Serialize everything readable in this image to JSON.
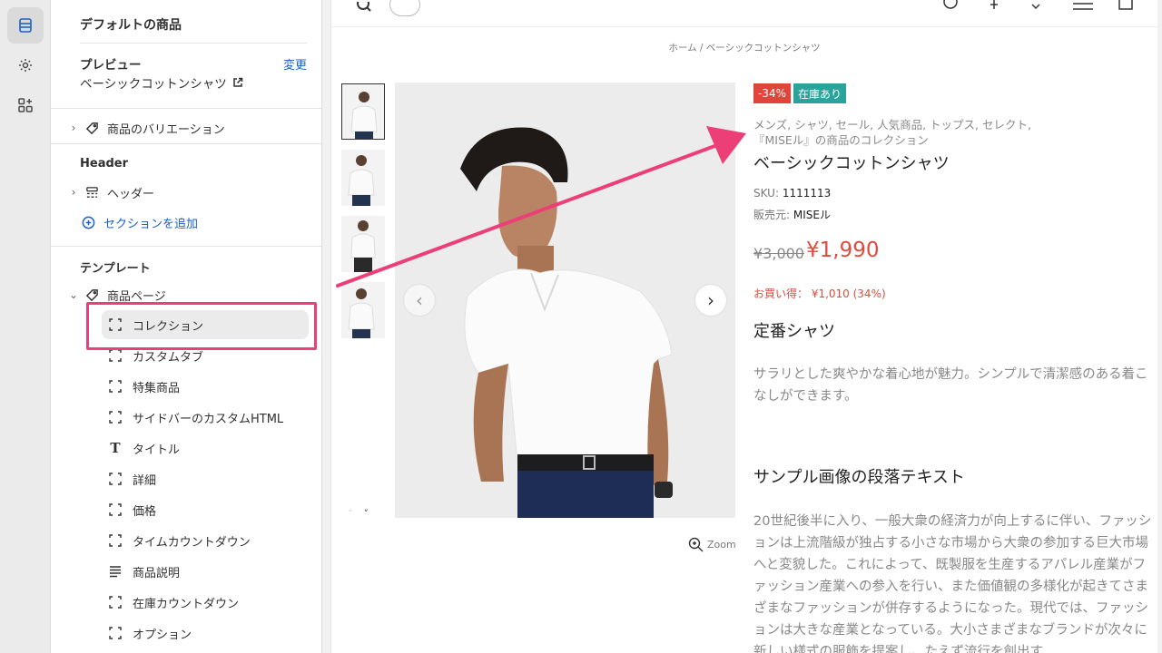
{
  "sidebar": {
    "title": "デフォルトの商品",
    "preview_label": "プレビュー",
    "preview_change": "変更",
    "preview_value": "ベーシックコットンシャツ",
    "variations_label": "商品のバリエーション",
    "header_section": "Header",
    "header_item": "ヘッダー",
    "add_section": "セクションを追加",
    "template_section": "テンプレート",
    "product_page": "商品ページ",
    "items": [
      {
        "label": "コレクション",
        "icon": "block-icon"
      },
      {
        "label": "カスタムタブ",
        "icon": "block-icon"
      },
      {
        "label": "特集商品",
        "icon": "block-icon"
      },
      {
        "label": "サイドバーのカスタムHTML",
        "icon": "block-icon"
      },
      {
        "label": "タイトル",
        "icon": "text-icon"
      },
      {
        "label": "詳細",
        "icon": "block-icon"
      },
      {
        "label": "価格",
        "icon": "block-icon"
      },
      {
        "label": "タイムカウントダウン",
        "icon": "block-icon"
      },
      {
        "label": "商品説明",
        "icon": "lines-icon"
      },
      {
        "label": "在庫カウントダウン",
        "icon": "block-icon"
      },
      {
        "label": "オプション",
        "icon": "block-icon"
      }
    ]
  },
  "preview": {
    "breadcrumb": "ホーム / ベーシックコットンシャツ",
    "zoom_label": "Zoom",
    "badge_discount": "-34%",
    "badge_stock": "在庫あり",
    "tags": "メンズ, シャツ, セール, 人気商品, トップス, セレクト, 『MISEル』の商品のコレクション",
    "title": "ベーシックコットンシャツ",
    "sku_label": "SKU:",
    "sku_value": "1111113",
    "vendor_label": "販売元:",
    "vendor_value": "MISEル",
    "old_price": "¥3,000",
    "new_price": "¥1,990",
    "saving": "お買い得： ¥1,010 (34%)",
    "subtitle": "定番シャツ",
    "description": "サラリとした爽やかな着心地が魅力。シンプルで清潔感のある着こなしができます。",
    "section_heading": "サンプル画像の段落テキスト",
    "section_paragraph": "20世紀後半に入り、一般大衆の経済力が向上するに伴い、ファッションは上流階級が独占する小さな市場から大衆の参加する巨大市場へと変貌した。これによって、既製服を生産するアパレル産業がファッション産業への参入を行い、また価値観の多様化が起きてさまざまなファッションが併存するようになった。現代では、ファッションは大きな産業となっている。大小さまざまなブランドが次々に新しい様式の服飾を提案し、たえず流行を創出す"
  },
  "colors": {
    "accent": "#1a62c5",
    "highlight": "#e8407a",
    "discount_badge": "#e0443a",
    "stock_badge": "#2aa39b",
    "price": "#e04a3d"
  }
}
